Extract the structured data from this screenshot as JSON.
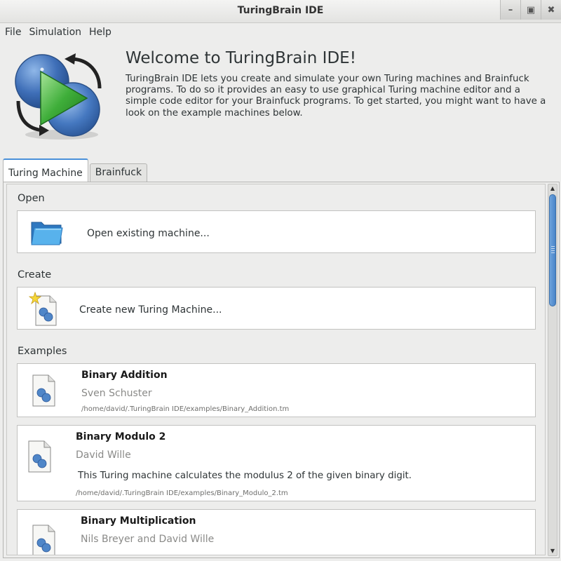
{
  "window": {
    "title": "TuringBrain IDE"
  },
  "menu": [
    "File",
    "Simulation",
    "Help"
  ],
  "welcome": {
    "title": "Welcome to TuringBrain IDE!",
    "text": "TuringBrain IDE lets you create and simulate your own Turing machines and Brainfuck programs. To do so it provides an easy to use graphical Turing machine editor and a simple code editor for your Brainfuck programs. To get started, you might want to have a look on the example machines below."
  },
  "tabs": [
    "Turing Machine",
    "Brainfuck"
  ],
  "sections": {
    "open": {
      "label": "Open",
      "item": "Open existing machine..."
    },
    "create": {
      "label": "Create",
      "item": "Create new Turing Machine..."
    },
    "examples": {
      "label": "Examples",
      "items": [
        {
          "title": "Binary Addition",
          "author": "Sven Schuster",
          "description": "",
          "path": "/home/david/.TuringBrain IDE/examples/Binary_Addition.tm"
        },
        {
          "title": "Binary Modulo 2",
          "author": "David Wille",
          "description": "This Turing machine calculates the modulus 2 of the given binary digit.",
          "path": "/home/david/.TuringBrain IDE/examples/Binary_Modulo_2.tm"
        },
        {
          "title": "Binary Multiplication",
          "author": "Nils Breyer and David Wille",
          "description": "",
          "path": ""
        }
      ]
    }
  },
  "colors": {
    "accent": "#4a90d9",
    "logo_green": "#3fae3a",
    "logo_blue": "#3f6fb8",
    "folder_blue": "#4aa3e0"
  },
  "icons": {
    "logo": "turingbrain-logo-icon",
    "open": "folder-icon",
    "create": "new-document-star-icon",
    "example": "turing-machine-document-icon"
  }
}
